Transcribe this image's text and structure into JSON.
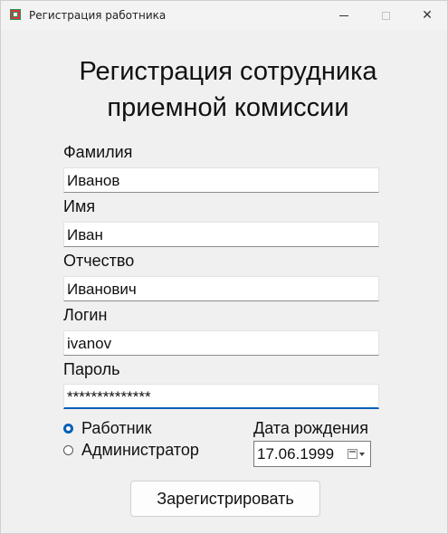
{
  "window": {
    "title": "Регистрация работника"
  },
  "titlebar": {
    "close_glyph": "✕"
  },
  "heading": {
    "line1": "Регистрация сотрудника",
    "line2": "приемной комиссии"
  },
  "form": {
    "fields": [
      {
        "label": "Фамилия",
        "value": "Иванов"
      },
      {
        "label": "Имя",
        "value": "Иван"
      },
      {
        "label": "Отчество",
        "value": "Иванович"
      },
      {
        "label": "Логин",
        "value": "ivanov"
      },
      {
        "label": "Пароль",
        "value": "**************"
      }
    ],
    "roles": [
      {
        "label": "Работник",
        "checked": true
      },
      {
        "label": "Администратор",
        "checked": false
      }
    ],
    "birth_date": {
      "label": "Дата рождения",
      "value": "17.06.1999"
    },
    "submit_label": "Зарегистрировать"
  },
  "colors": {
    "accent": "#005fb8"
  }
}
